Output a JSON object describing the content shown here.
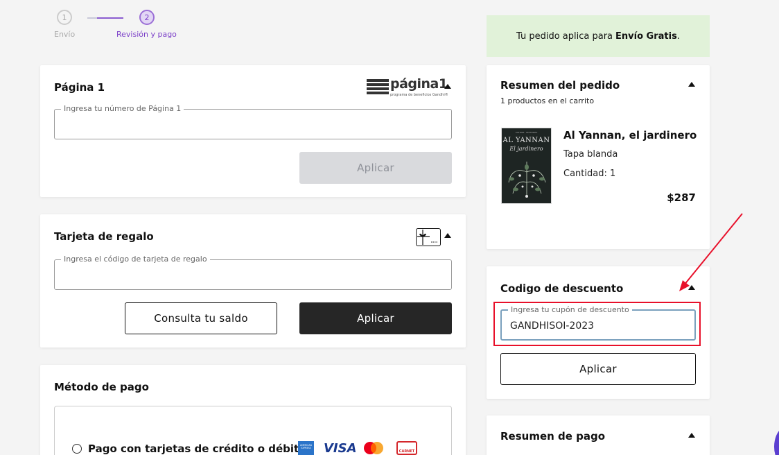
{
  "stepper": {
    "steps": [
      {
        "number": "1",
        "label": "Envío"
      },
      {
        "number": "2",
        "label": "Revisión y pago"
      }
    ]
  },
  "pagina1": {
    "title": "Página 1",
    "logo_text": "página1",
    "logo_subtext": "programa de beneficios Gandhi®",
    "field_label": "Ingresa tu número de Página 1",
    "field_value": "",
    "apply_label": "Aplicar"
  },
  "gift_card": {
    "title": "Tarjeta de regalo",
    "icon": "gift-card-icon",
    "field_label": "Ingresa el código de tarjeta de regalo",
    "field_value": "",
    "balance_label": "Consulta tu saldo",
    "apply_label": "Aplicar"
  },
  "payment_method": {
    "title": "Método de pago",
    "option_label": "Pago con tarjetas de crédito o débito",
    "cards": [
      "AMERICAN EXPRESS",
      "VISA",
      "mastercard",
      "CARNET"
    ]
  },
  "notice": {
    "text": "Tu pedido aplica para",
    "bold": "Envío Gratis",
    "suffix": "."
  },
  "order_summary": {
    "title": "Resumen del pedido",
    "count": "1 productos en el carrito",
    "product": {
      "cover_author": "AUTHOR · EDITORIAL",
      "cover_title": "AL YANNAN",
      "cover_subtitle": "El jardinero",
      "name": "Al Yannan, el jardinero",
      "format": "Tapa blanda",
      "quantity": "Cantidad: 1",
      "price": "$287"
    }
  },
  "discount": {
    "title": "Codigo de descuento",
    "field_label": "Ingresa tu cupón de descuento",
    "field_value": "GANDHISOI-2023",
    "apply_label": "Aplicar"
  },
  "payment_summary": {
    "title": "Resumen de pago"
  },
  "colors": {
    "accent": "#7b3fc8",
    "notice_bg": "#e1f2d9",
    "highlight": "#e8102a",
    "dark_button": "#262626"
  }
}
